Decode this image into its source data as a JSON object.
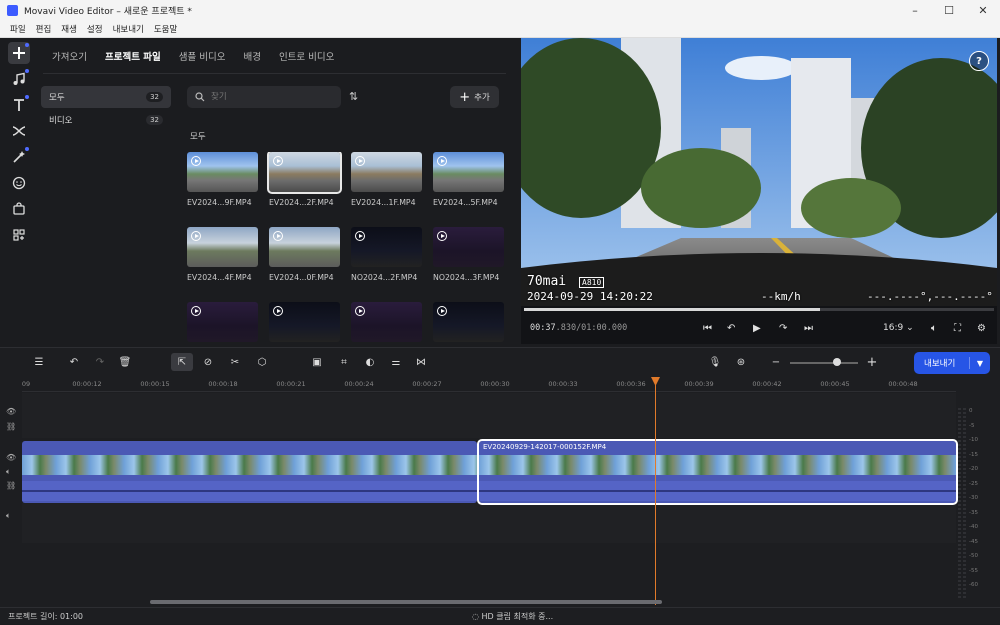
{
  "window": {
    "title": "Movavi Video Editor – 새로운 프로젝트 *",
    "min": "–",
    "max": "☐",
    "close": "✕"
  },
  "menu": [
    "파일",
    "편집",
    "재생",
    "설정",
    "내보내기",
    "도움말"
  ],
  "media": {
    "tabs": [
      "가져오기",
      "프로젝트 파일",
      "샘플 비디오",
      "배경",
      "인트로 비디오"
    ],
    "active_tab": 1,
    "categories": [
      {
        "label": "모두",
        "count": "32"
      },
      {
        "label": "비디오",
        "count": "32"
      }
    ],
    "search_placeholder": "찾기",
    "add_label": "추가",
    "section_label": "모두",
    "files": [
      {
        "name": "EV2024...9F.MP4",
        "style": "day"
      },
      {
        "name": "EV2024...2F.MP4",
        "style": "day2"
      },
      {
        "name": "EV2024...1F.MP4",
        "style": "day2"
      },
      {
        "name": "EV2024...5F.MP4",
        "style": "day"
      },
      {
        "name": "EV2024...4F.MP4",
        "style": "cloud"
      },
      {
        "name": "EV2024...0F.MP4",
        "style": "cloud"
      },
      {
        "name": "NO2024...2F.MP4",
        "style": "night"
      },
      {
        "name": "NO2024...3F.MP4",
        "style": "purple"
      },
      {
        "name": "",
        "style": "purple"
      },
      {
        "name": "",
        "style": "night"
      },
      {
        "name": "",
        "style": "purple"
      },
      {
        "name": "",
        "style": "night"
      }
    ]
  },
  "preview": {
    "help": "?",
    "osd_brand": "70mai",
    "osd_model": "A810",
    "osd_datetime": "2024-09-29 14:20:22",
    "osd_speed": "--km/h",
    "osd_gps": "---.----°,---.----°",
    "time_current": "00:37",
    "time_rest": ".830/01:00.000",
    "progress": 0.63,
    "aspect": "16:9"
  },
  "timeline": {
    "export_label": "내보내기",
    "ticks": [
      "09",
      "00:00:12",
      "00:00:15",
      "00:00:18",
      "00:00:21",
      "00:00:24",
      "00:00:27",
      "00:00:30",
      "00:00:33",
      "00:00:36",
      "00:00:39",
      "00:00:42",
      "00:00:45",
      "00:00:48"
    ],
    "clip2_name": "EV20240929-142017-000152F.MP4",
    "db_labels": [
      "0",
      "-5",
      "-10",
      "-15",
      "-20",
      "-25",
      "-30",
      "-35",
      "-40",
      "-45",
      "-50",
      "-55",
      "-60"
    ]
  },
  "status": {
    "length": "프로젝트 길이: 01:00",
    "optimizing": "HD 클립 최적화 중..."
  },
  "colors": {
    "accent": "#2755e6",
    "playhead": "#e07a2a",
    "clip": "#4b59b5"
  }
}
